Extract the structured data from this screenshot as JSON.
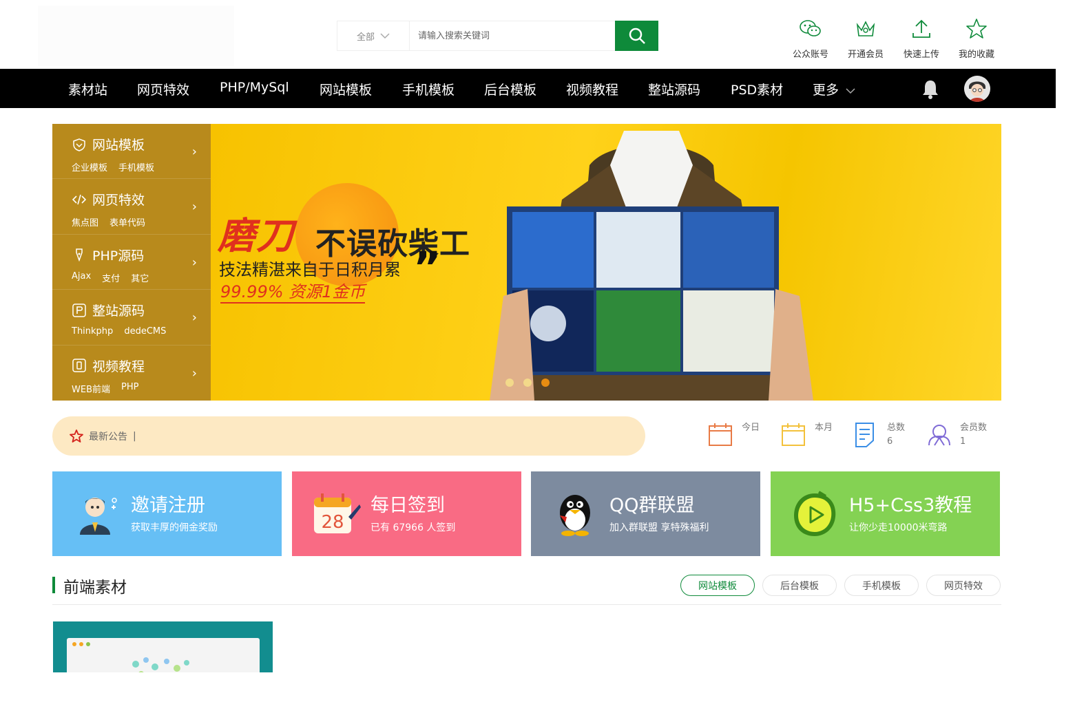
{
  "search": {
    "category": "全部",
    "placeholder": "请输入搜索关键词"
  },
  "quick_links": [
    {
      "label": "公众账号",
      "icon": "wechat-icon"
    },
    {
      "label": "开通会员",
      "icon": "vip-crown-icon"
    },
    {
      "label": "快速上传",
      "icon": "upload-icon"
    },
    {
      "label": "我的收藏",
      "icon": "star-icon"
    }
  ],
  "nav": {
    "items": [
      "素材站",
      "网页特效",
      "PHP/MySql",
      "网站模板",
      "手机模板",
      "后台模板",
      "视频教程",
      "整站源码",
      "PSD素材",
      "更多"
    ],
    "bell_icon": "bell-icon",
    "avatar_icon": "user-avatar"
  },
  "category_menu": [
    {
      "title": "网站模板",
      "icon": "gift-icon",
      "subs": [
        "企业模板",
        "手机模板"
      ]
    },
    {
      "title": "网页特效",
      "icon": "code-icon",
      "subs": [
        "焦点图",
        "表单代码"
      ]
    },
    {
      "title": "PHP源码",
      "icon": "pen-icon",
      "subs": [
        "Ajax",
        "支付",
        "其它"
      ]
    },
    {
      "title": "整站源码",
      "icon": "p-box-icon",
      "subs": [
        "Thinkphp",
        "dedeCMS"
      ]
    },
    {
      "title": "视频教程",
      "icon": "video-icon",
      "subs": [
        "WEB前端",
        "PHP"
      ]
    }
  ],
  "banner": {
    "big_red": "磨刀",
    "big_black": "不误砍柴工",
    "line2": "技法精湛来自于日积月累",
    "quote": "”",
    "line3": "99.99% 资源1金币",
    "slides_total": 3,
    "active_slide": 3,
    "colors": {
      "yellow": "#ffd21a",
      "red": "#e0301e",
      "menu": "#b88a1c"
    }
  },
  "notice": {
    "label": "最新公告",
    "cursor": "|"
  },
  "stats": [
    {
      "label": "今日",
      "value": "",
      "icon": "calendar-icon",
      "color": "#e87a45"
    },
    {
      "label": "本月",
      "value": "",
      "icon": "calendar-month-icon",
      "color": "#f3c13b"
    },
    {
      "label": "总数",
      "value": "6",
      "icon": "document-icon",
      "color": "#3a8ee6"
    },
    {
      "label": "会员数",
      "value": "1",
      "icon": "members-icon",
      "color": "#7f6bd6"
    }
  ],
  "cards": [
    {
      "title": "邀请注册",
      "sub": "获取丰厚的佣金奖励",
      "color": "#66bff5",
      "icon": "invite-icon"
    },
    {
      "title": "每日签到",
      "sub": "已有 67966 人签到",
      "color": "#f96b84",
      "icon": "calendar-28-icon",
      "day": "28"
    },
    {
      "title": "QQ群联盟",
      "sub": "加入群联盟 享特殊福利",
      "color": "#7d8b9f",
      "icon": "qq-penguin-icon"
    },
    {
      "title": "H5+Css3教程",
      "sub": "让你少走10000米弯路",
      "color": "#84d253",
      "icon": "play-icon"
    }
  ],
  "section": {
    "title": "前端素材",
    "tabs": [
      "网站模板",
      "后台模板",
      "手机模板",
      "网页特效"
    ],
    "active_tab": 0
  }
}
